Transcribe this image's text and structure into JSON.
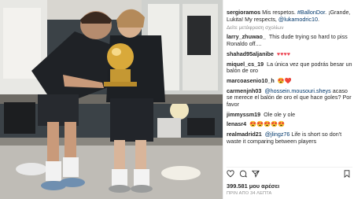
{
  "photo": {
    "caption": ""
  },
  "comments": [
    {
      "user": "sergioramos",
      "text": "Mis respetos. ",
      "mention": "#BallonDor",
      "rest": ". ¡Grande, Lukita! My respects, ",
      "mention2": "@lukamodric10",
      "rest2": "."
    },
    {
      "user": "",
      "text": "Δείτε μετάφραση σχολίων"
    },
    {
      "user": "larry_zhuwao_",
      "text": "This dude trying so hard to piss Ronaldo off...."
    },
    {
      "user": "shahad95aljanibe",
      "text": "♥♥♥♥"
    },
    {
      "user": "miquel_cs_19",
      "text": "La única vez que podrás besar un balón de oro"
    },
    {
      "user": "marcoasenio10_h",
      "text": "😍❤️"
    },
    {
      "user": "carmenjnh03",
      "mention": "@hossein.mousouri.sheys",
      "text": " acaso se merece el balón de oro el que hace goles? Por favor"
    },
    {
      "user": "jimmyssm19",
      "text": "Ole ole y ole"
    },
    {
      "user": "lenasr4",
      "text": "😍😍😍😍😍"
    },
    {
      "user": "realmadrid21",
      "mention": "@jlingz76",
      "text": " Life is short so don't waste it comparing between players"
    }
  ],
  "stats": {
    "likes": "399.581 μου αρέσει",
    "time": "ΠΡΙΝ ΑΠΟ 34 ΛΕΠΤΑ"
  },
  "icons": {
    "like": "heart-icon",
    "comment": "comment-icon",
    "share": "share-icon",
    "save": "bookmark-icon"
  }
}
